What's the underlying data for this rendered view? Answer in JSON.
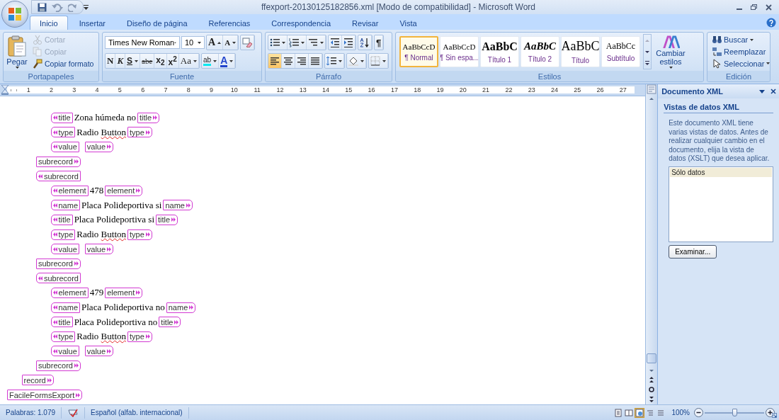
{
  "title_bar": {
    "title": "ffexport-20130125182856.xml [Modo de compatibilidad] - Microsoft Word"
  },
  "tabs": [
    {
      "label": "Inicio",
      "selected": true
    },
    {
      "label": "Insertar",
      "selected": false
    },
    {
      "label": "Diseño de página",
      "selected": false
    },
    {
      "label": "Referencias",
      "selected": false
    },
    {
      "label": "Correspondencia",
      "selected": false
    },
    {
      "label": "Revisar",
      "selected": false
    },
    {
      "label": "Vista",
      "selected": false
    }
  ],
  "ribbon": {
    "clipboard": {
      "group": "Portapapeles",
      "paste": "Pegar",
      "items": [
        {
          "kind": "cut",
          "label": "Cortar",
          "disabled": true
        },
        {
          "kind": "copy",
          "label": "Copiar",
          "disabled": true
        },
        {
          "kind": "painter",
          "label": "Copiar formato",
          "disabled": false
        }
      ]
    },
    "font": {
      "group": "Fuente",
      "name": "Times New Roman",
      "size": "10",
      "grow": "A",
      "shrink": "A",
      "format_buttons": [
        {
          "kind": "bold",
          "label": "N",
          "menu": false
        },
        {
          "kind": "italic",
          "label": "K",
          "menu": false
        },
        {
          "kind": "underline",
          "label": "S",
          "menu": true
        },
        {
          "kind": "strike",
          "label": "abe",
          "menu": false
        },
        {
          "kind": "sub",
          "label": "x$_{2}$",
          "menu": false
        },
        {
          "kind": "sup",
          "label": "x$^{2}$",
          "menu": false
        },
        {
          "kind": "case",
          "label": "Aa",
          "menu": true
        }
      ],
      "highlight": "ab",
      "font_color": "A"
    },
    "paragraph": {
      "group": "Párrafo",
      "show_marks": "¶",
      "alignments": [
        {
          "kind": "left",
          "selected": true
        },
        {
          "kind": "center",
          "selected": false
        },
        {
          "kind": "right",
          "selected": false
        },
        {
          "kind": "justify",
          "selected": false
        }
      ]
    },
    "styles": {
      "group": "Estilos",
      "items": [
        {
          "kind": "normal",
          "preview": "AaBbCcD",
          "label": "¶ Normal",
          "selected": true
        },
        {
          "kind": "normal",
          "preview": "AaBbCcD",
          "label": "¶ Sin espa...",
          "selected": false
        },
        {
          "kind": "heading1",
          "preview": "AaBbC",
          "label": "Título 1",
          "selected": false
        },
        {
          "kind": "heading2",
          "preview": "AaBbC",
          "label": "Título 2",
          "selected": false
        },
        {
          "kind": "title",
          "preview": "AaBbC",
          "label": "Título",
          "selected": false
        },
        {
          "kind": "subtitle",
          "preview": "AaBbCc",
          "label": "Subtítulo",
          "selected": false
        }
      ],
      "change": "Cambiar estilos"
    },
    "editing": {
      "group": "Edición",
      "items": [
        {
          "kind": "find",
          "label": "Buscar",
          "menu": true
        },
        {
          "kind": "replace",
          "label": "Reemplazar",
          "menu": false
        },
        {
          "kind": "select",
          "label": "Seleccionar",
          "menu": true
        }
      ]
    }
  },
  "ruler": {
    "numbers": [
      "1",
      "2",
      "3",
      "4",
      "5",
      "6",
      "7",
      "8",
      "9",
      "10",
      "11",
      "12",
      "13",
      "14",
      "15",
      "16",
      "17",
      "18",
      "19",
      "20",
      "21",
      "22",
      "23",
      "24",
      "25",
      "26",
      "27"
    ]
  },
  "document": {
    "nodes": [
      {
        "close_tag": "FacileFormsExport",
        "children": [
          {
            "close_tag": "record",
            "children": [
              {
                "close_tag": "subrecord",
                "children": [
                  {
                    "open_tag": "title",
                    "value": "Zona húmeda no",
                    "close_tag": "title",
                    "misspelled": false
                  },
                  {
                    "open_tag": "type",
                    "value": "Radio Button",
                    "close_tag": "type",
                    "misspelled": true
                  },
                  {
                    "open_tag": "value",
                    "close_tag": "value"
                  }
                ]
              },
              {
                "open_tag": "subrecord",
                "close_tag": "subrecord",
                "children": [
                  {
                    "open_tag": "element",
                    "value": "478",
                    "close_tag": "element",
                    "misspelled": false
                  },
                  {
                    "open_tag": "name",
                    "value": "Placa Polideportiva si",
                    "close_tag": "name",
                    "misspelled": false
                  },
                  {
                    "open_tag": "title",
                    "value": "Placa Polideportiva si",
                    "close_tag": "title",
                    "misspelled": false
                  },
                  {
                    "open_tag": "type",
                    "value": "Radio Button",
                    "close_tag": "type",
                    "misspelled": true
                  },
                  {
                    "open_tag": "value",
                    "close_tag": "value"
                  }
                ]
              },
              {
                "open_tag": "subrecord",
                "close_tag": "subrecord",
                "children": [
                  {
                    "open_tag": "element",
                    "value": "479",
                    "close_tag": "element",
                    "misspelled": false
                  },
                  {
                    "open_tag": "name",
                    "value": "Placa Polideportiva no",
                    "close_tag": "name",
                    "misspelled": false
                  },
                  {
                    "open_tag": "title",
                    "value": "Placa Polideportiva no",
                    "close_tag": "title",
                    "misspelled": false
                  },
                  {
                    "open_tag": "type",
                    "value": "Radio Button",
                    "close_tag": "type",
                    "misspelled": true
                  },
                  {
                    "open_tag": "value",
                    "close_tag": "value"
                  }
                ]
              }
            ]
          }
        ]
      }
    ]
  },
  "xml_pane": {
    "title": "Documento XML",
    "heading": "Vistas de datos XML",
    "text": "Este documento XML tiene varias vistas de datos. Antes de realizar cualquier cambio en el documento, elija la vista de datos (XSLT) que desea aplicar.",
    "views": [
      {
        "label": "Sólo datos",
        "selected": true
      }
    ],
    "browse": "Examinar..."
  },
  "status_bar": {
    "words": "Palabras: 1.079",
    "language": "Español (alfab. internacional)",
    "views": [
      {
        "kind": "print",
        "selected": false
      },
      {
        "kind": "reading",
        "selected": false
      },
      {
        "kind": "web",
        "selected": true
      },
      {
        "kind": "outline",
        "selected": false
      },
      {
        "kind": "draft",
        "selected": false
      }
    ],
    "zoom": "100%",
    "zoom_level": {
      "level": 0.5
    }
  }
}
